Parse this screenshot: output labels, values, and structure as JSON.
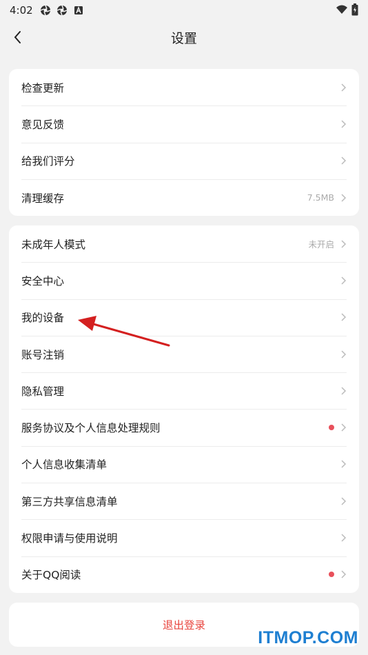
{
  "status_bar": {
    "time": "4:02",
    "icons": [
      "aperture-icon",
      "aperture-icon",
      "a-badge-icon"
    ],
    "right_icons": [
      "wifi-icon",
      "battery-icon"
    ]
  },
  "header": {
    "title": "设置",
    "back_icon": "chevron-left-icon"
  },
  "group1": {
    "items": [
      {
        "label": "检查更新",
        "value": ""
      },
      {
        "label": "意见反馈",
        "value": ""
      },
      {
        "label": "给我们评分",
        "value": ""
      },
      {
        "label": "清理缓存",
        "value": "7.5MB"
      }
    ]
  },
  "group2": {
    "items": [
      {
        "label": "未成年人模式",
        "value": "未开启",
        "dot": false
      },
      {
        "label": "安全中心",
        "value": "",
        "dot": false
      },
      {
        "label": "我的设备",
        "value": "",
        "dot": false
      },
      {
        "label": "账号注销",
        "value": "",
        "dot": false
      },
      {
        "label": "隐私管理",
        "value": "",
        "dot": false
      },
      {
        "label": "服务协议及个人信息处理规则",
        "value": "",
        "dot": true
      },
      {
        "label": "个人信息收集清单",
        "value": "",
        "dot": false
      },
      {
        "label": "第三方共享信息清单",
        "value": "",
        "dot": false
      },
      {
        "label": "权限申请与使用说明",
        "value": "",
        "dot": false
      },
      {
        "label": "关于QQ阅读",
        "value": "",
        "dot": true
      }
    ]
  },
  "logout": {
    "label": "退出登录"
  },
  "watermark": {
    "text": "ITMOP.COM"
  },
  "colors": {
    "accent_red": "#e8433c",
    "dot_red": "#e8505b",
    "watermark_blue": "#1e7fd1",
    "annotation_arrow": "#d42020"
  }
}
